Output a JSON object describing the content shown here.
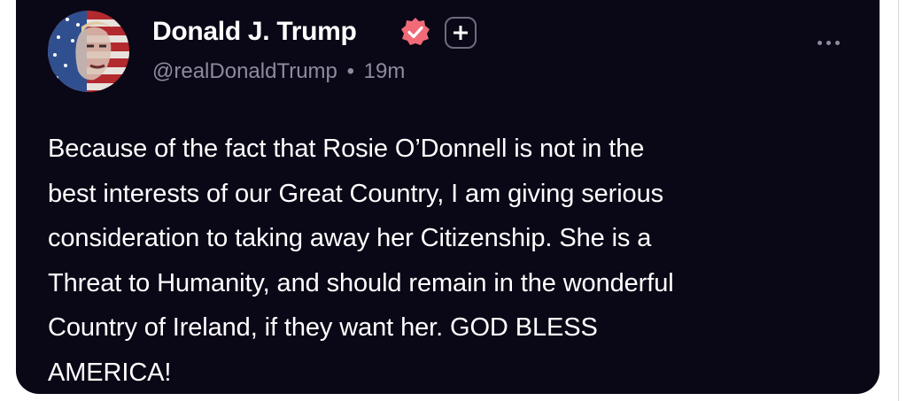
{
  "post": {
    "author": {
      "display_name": "Donald J. Trump",
      "handle": "@realDonaldTrump",
      "separator": "•",
      "time_ago": "19m",
      "avatar_icon": "flag-portrait-avatar",
      "verified_icon": "verified-badge-icon",
      "verified_color": "#f06a78",
      "subscribe_icon": "plus-icon"
    },
    "more_icon": "more-options-icon",
    "body": "Because of the fact that Rosie O’Donnell is not in the\nbest interests of our Great Country, I am giving serious\nconsideration to taking away her Citizenship. She is a\nThreat to Humanity, and should remain in the wonderful\nCountry of Ireland, if they want her. GOD BLESS\nAMERICA!"
  },
  "colors": {
    "card_background": "#0a0716",
    "text_primary": "#ffffff",
    "text_secondary": "#8e8ba0"
  }
}
